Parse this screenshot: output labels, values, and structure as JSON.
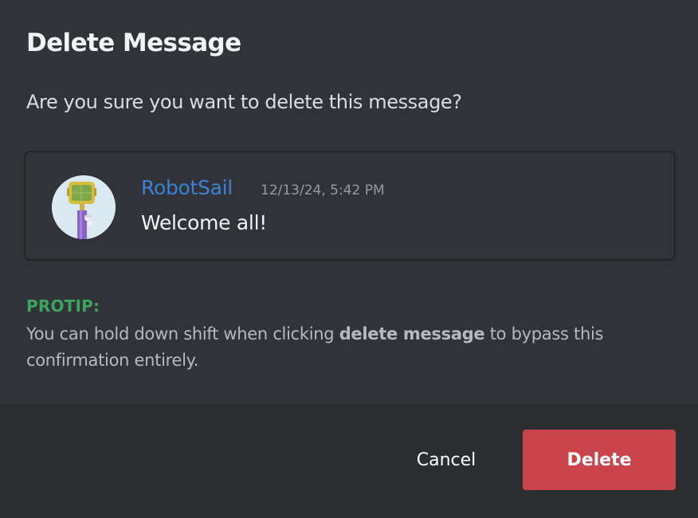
{
  "dialog": {
    "title": "Delete Message",
    "question": "Are you sure you want to delete this message?"
  },
  "message": {
    "author": "RobotSail",
    "timestamp": "12/13/24, 5:42 PM",
    "content": "Welcome all!",
    "author_color": "#3b82d6",
    "avatar_icon": "robot-avatar"
  },
  "protip": {
    "label": "PROTIP:",
    "text_before": "You can hold down shift when clicking ",
    "text_bold": "delete message",
    "text_after": " to bypass this confirmation entirely.",
    "label_color": "#3ba55d"
  },
  "buttons": {
    "cancel_label": "Cancel",
    "delete_label": "Delete",
    "delete_color": "#c9444a"
  }
}
